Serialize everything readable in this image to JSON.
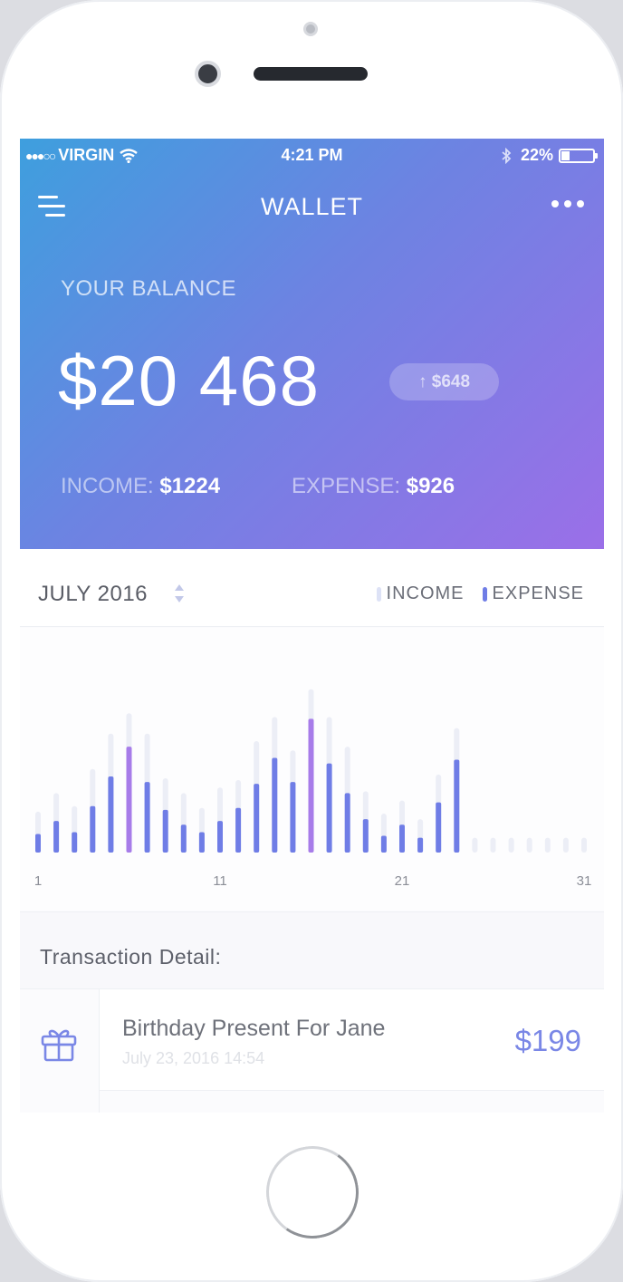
{
  "colors": {
    "accent": "#7a87e6",
    "expense_bar": "#6f7de6",
    "expense_highlight": "#a77ce9",
    "income_bar": "#eceef6"
  },
  "status_bar": {
    "signal": "●●●○○",
    "carrier": "VIRGIN",
    "time": "4:21 PM",
    "battery": "22%"
  },
  "nav": {
    "title": "WALLET"
  },
  "balance": {
    "label": "YOUR BALANCE",
    "value": "$20 468",
    "change": "↑ $648",
    "income_label": "INCOME:",
    "income_value": "$1224",
    "expense_label": "EXPENSE:",
    "expense_value": "$926"
  },
  "month_bar": {
    "month": "JULY 2016",
    "legend_income": "INCOME",
    "legend_expense": "EXPENSE"
  },
  "chart_data": {
    "type": "bar",
    "x_ticks": [
      "1",
      "11",
      "21",
      "31"
    ],
    "days": [
      1,
      2,
      3,
      4,
      5,
      6,
      7,
      8,
      9,
      10,
      11,
      12,
      13,
      14,
      15,
      16,
      17,
      18,
      19,
      20,
      21,
      22,
      23,
      24,
      25,
      26,
      27,
      28,
      29,
      30,
      31
    ],
    "series": [
      {
        "name": "INCOME",
        "values": [
          22,
          32,
          25,
          45,
          64,
          75,
          64,
          40,
          32,
          24,
          35,
          39,
          60,
          73,
          55,
          88,
          73,
          57,
          33,
          21,
          28,
          18,
          42,
          67,
          8,
          8,
          8,
          8,
          8,
          8,
          8
        ]
      },
      {
        "name": "EXPENSE",
        "values": [
          10,
          17,
          11,
          25,
          41,
          57,
          38,
          23,
          15,
          11,
          17,
          24,
          37,
          51,
          38,
          72,
          48,
          32,
          18,
          9,
          15,
          8,
          27,
          50,
          0,
          0,
          0,
          0,
          0,
          0,
          0
        ]
      }
    ],
    "highlight_days": [
      6,
      16
    ]
  },
  "transactions": {
    "title": "Transaction Detail:",
    "items": [
      {
        "name": "Birthday Present For Jane",
        "date": "July 23, 2016   14:54",
        "amount": "$199",
        "icon": "gift-icon"
      }
    ]
  }
}
